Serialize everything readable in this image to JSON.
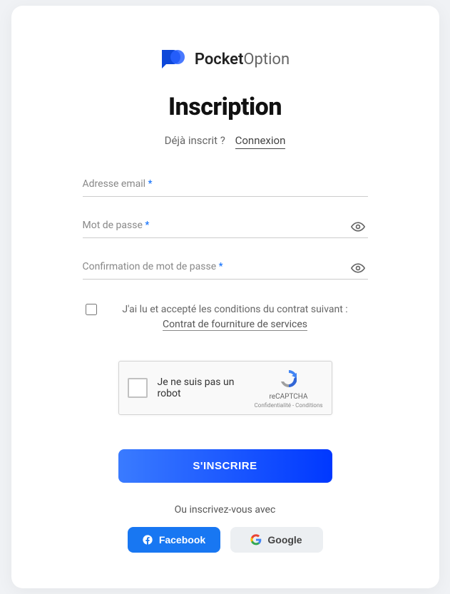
{
  "brand": {
    "name_bold": "Pocket",
    "name_light": "Option"
  },
  "title": "Inscription",
  "already": {
    "question": "Déjà inscrit ?",
    "login": "Connexion"
  },
  "fields": {
    "email_label": "Adresse email",
    "password_label": "Mot de passe",
    "confirm_label": "Confirmation de mot de passe",
    "required_mark": "*"
  },
  "consent": {
    "text_prefix": "J'ai lu et accepté les conditions du contrat suivant : ",
    "link": "Contrat de fourniture de services"
  },
  "captcha": {
    "label": "Je ne suis pas un robot",
    "brand": "reCAPTCHA",
    "links": "Confidentialité - Conditions"
  },
  "submit": "S'INSCRIRE",
  "or": "Ou inscrivez-vous avec",
  "social": {
    "facebook": "Facebook",
    "google": "Google"
  }
}
